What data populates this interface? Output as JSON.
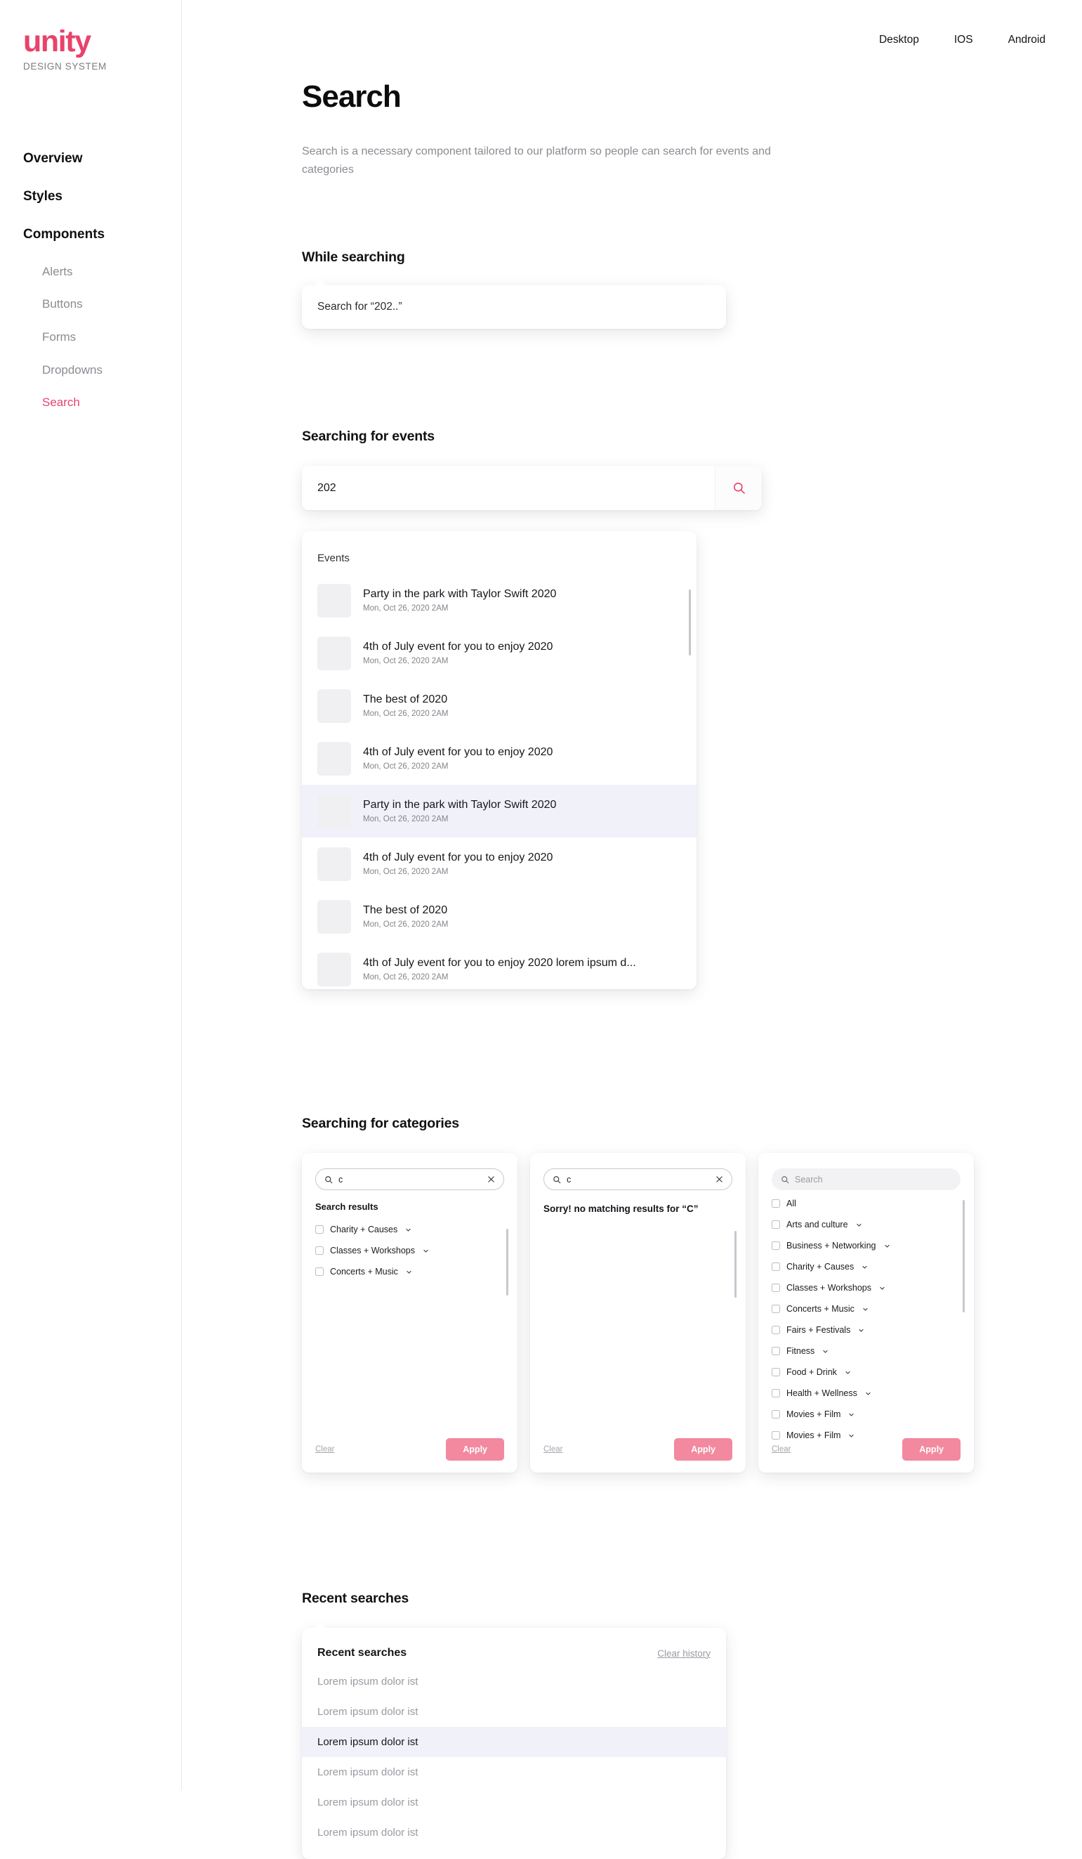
{
  "brand": {
    "name": "unity",
    "tagline": "DESIGN SYSTEM",
    "accent": "#e8436b",
    "apply_pink": "#f2899f",
    "highlight": "#f1f1fa"
  },
  "topbar": {
    "items": [
      {
        "label": "Desktop"
      },
      {
        "label": "IOS"
      },
      {
        "label": "Android"
      }
    ]
  },
  "sidebar": {
    "groups": [
      {
        "label": "Overview"
      },
      {
        "label": "Styles"
      },
      {
        "label": "Components"
      }
    ],
    "components": [
      {
        "label": "Alerts",
        "active": false
      },
      {
        "label": "Buttons",
        "active": false
      },
      {
        "label": "Forms",
        "active": false
      },
      {
        "label": "Dropdowns",
        "active": false
      },
      {
        "label": "Search",
        "active": true
      }
    ]
  },
  "page": {
    "title": "Search",
    "description": "Search is a necessary component tailored to our platform so people can search for events and categories"
  },
  "while_searching": {
    "section_title": "While searching",
    "suggestion": "Search for “202..”"
  },
  "searching_events": {
    "section_title": "Searching for events",
    "input_value": "202",
    "input_placeholder": "Search",
    "search_icon": "search-icon",
    "dropdown_label": "Events",
    "results": [
      {
        "title": "Party in the park with Taylor Swift 2020",
        "date": "Mon, Oct 26, 2020 2AM",
        "selected": false
      },
      {
        "title": "4th of July event for you to enjoy 2020",
        "date": "Mon, Oct 26, 2020 2AM",
        "selected": false
      },
      {
        "title": "The best of 2020",
        "date": "Mon, Oct 26, 2020 2AM",
        "selected": false
      },
      {
        "title": "4th of July event for you to enjoy 2020",
        "date": "Mon, Oct 26, 2020 2AM",
        "selected": false
      },
      {
        "title": "Party in the park with Taylor Swift 2020",
        "date": "Mon, Oct 26, 2020 2AM",
        "selected": true
      },
      {
        "title": "4th of July event for you to enjoy 2020",
        "date": "Mon, Oct 26, 2020 2AM",
        "selected": false
      },
      {
        "title": "The best of 2020",
        "date": "Mon, Oct 26, 2020 2AM",
        "selected": false
      },
      {
        "title": "4th of July event for you to enjoy 2020 lorem ipsum d...",
        "date": "Mon, Oct 26, 2020 2AM",
        "selected": false
      }
    ]
  },
  "searching_categories": {
    "section_title": "Searching for categories",
    "cards": [
      {
        "search_value": "c",
        "search_placeholder": "Search",
        "has_clear": true,
        "results_label": "Search results",
        "items": [
          {
            "label": "Charity + Causes",
            "has_chevron": true
          },
          {
            "label": "Classes + Workshops",
            "has_chevron": true
          },
          {
            "label": "Concerts + Music",
            "has_chevron": true
          }
        ],
        "clear_label": "Clear",
        "apply_label": "Apply"
      },
      {
        "search_value": "c",
        "search_placeholder": "Search",
        "has_clear": true,
        "empty_message": "Sorry! no matching results for “C”",
        "items": [],
        "clear_label": "Clear",
        "apply_label": "Apply"
      },
      {
        "search_value": "",
        "search_placeholder": "Search",
        "has_clear": false,
        "items": [
          {
            "label": "All",
            "has_chevron": false
          },
          {
            "label": "Arts and culture",
            "has_chevron": true
          },
          {
            "label": "Business + Networking",
            "has_chevron": true
          },
          {
            "label": "Charity + Causes",
            "has_chevron": true
          },
          {
            "label": "Classes + Workshops",
            "has_chevron": true
          },
          {
            "label": "Concerts + Music",
            "has_chevron": true
          },
          {
            "label": "Fairs + Festivals",
            "has_chevron": true
          },
          {
            "label": "Fitness",
            "has_chevron": true
          },
          {
            "label": "Food + Drink",
            "has_chevron": true
          },
          {
            "label": "Health + Wellness",
            "has_chevron": true
          },
          {
            "label": "Movies + Film",
            "has_chevron": true
          },
          {
            "label": "Movies + Film",
            "has_chevron": true
          }
        ],
        "clear_label": "Clear",
        "apply_label": "Apply"
      }
    ]
  },
  "recent_searches": {
    "section_title": "Recent searches",
    "card_title": "Recent searches",
    "clear_history_label": "Clear history",
    "items": [
      {
        "label": "Lorem ipsum dolor ist",
        "selected": false
      },
      {
        "label": "Lorem ipsum dolor ist",
        "selected": false
      },
      {
        "label": "Lorem ipsum dolor ist",
        "selected": true
      },
      {
        "label": "Lorem ipsum dolor ist",
        "selected": false
      },
      {
        "label": "Lorem ipsum dolor ist",
        "selected": false
      },
      {
        "label": "Lorem ipsum dolor ist",
        "selected": false
      }
    ]
  }
}
